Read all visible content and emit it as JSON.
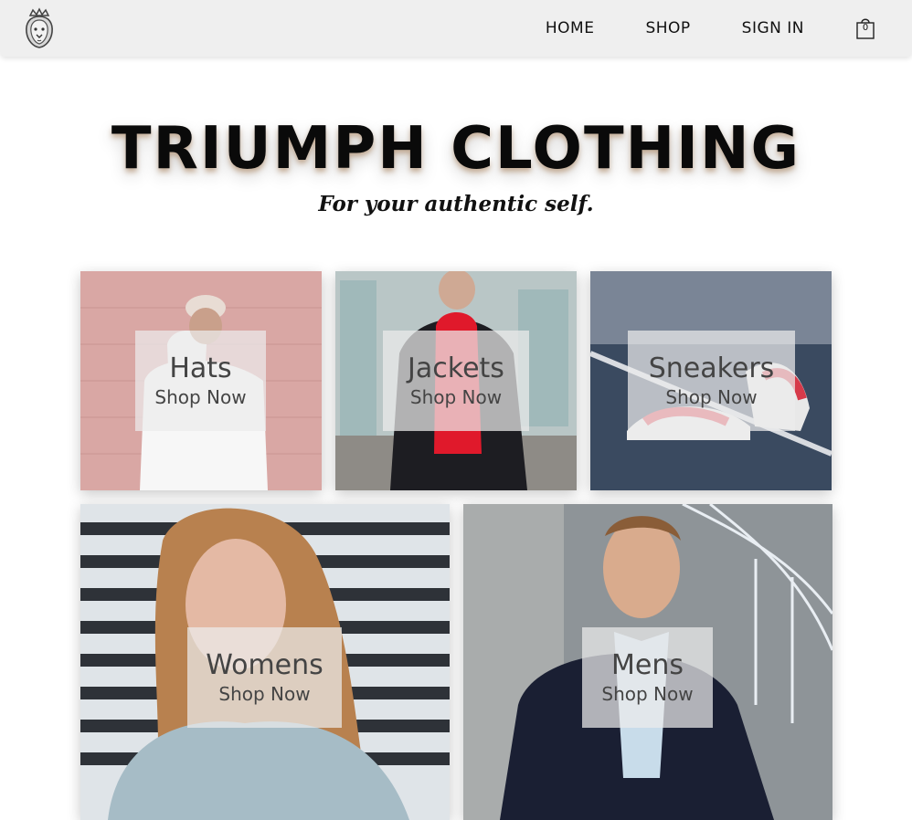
{
  "nav": {
    "links": [
      "HOME",
      "SHOP",
      "SIGN IN"
    ],
    "cart_count": "0",
    "logo_icon": "lion-crown-icon",
    "cart_icon": "shopping-bag-icon"
  },
  "hero": {
    "title": "TRIUMPH CLOTHING",
    "tagline": "For your authentic self."
  },
  "categories": [
    {
      "title": "Hats",
      "cta": "Shop Now"
    },
    {
      "title": "Jackets",
      "cta": "Shop Now"
    },
    {
      "title": "Sneakers",
      "cta": "Shop Now"
    },
    {
      "title": "Womens",
      "cta": "Shop Now"
    },
    {
      "title": "Mens",
      "cta": "Shop Now"
    }
  ]
}
